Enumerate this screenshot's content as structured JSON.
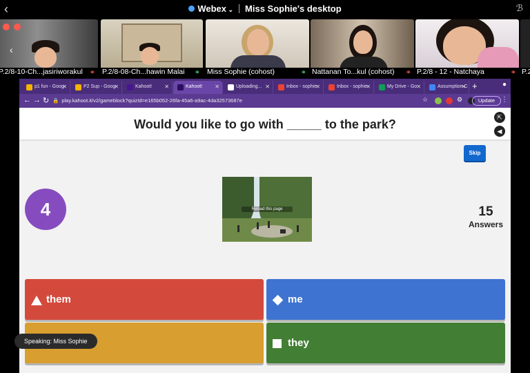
{
  "topbar": {
    "app_name": "Webex",
    "session_title": "Miss Sophie's desktop"
  },
  "participants": [
    {
      "name": "P.2/8-10-Ch...jasiriworakul",
      "mic": "off"
    },
    {
      "name": "P.2/8-08-Ch...hawin Malai",
      "mic": "on"
    },
    {
      "name": "Miss Sophie (cohost)",
      "mic": "on"
    },
    {
      "name": "Nattanan To...kul (cohost)",
      "mic": "off"
    },
    {
      "name": "P.2/8 - 12 - Natchaya",
      "mic": "off"
    },
    {
      "name": "P.2",
      "mic": "off"
    }
  ],
  "browser": {
    "tabs": [
      {
        "label": "p1 fun - Goog",
        "color": "#f4b400"
      },
      {
        "label": "P2 Sup - Goog",
        "color": "#f4b400"
      },
      {
        "label": "Kahoot!",
        "color": "#46178f"
      },
      {
        "label": "Kahoot!",
        "color": "#46178f"
      },
      {
        "label": "Uploading...",
        "color": "#ffffff"
      },
      {
        "label": "Inbox - sophie",
        "color": "#ea4335"
      },
      {
        "label": "Inbox - sophie",
        "color": "#ea4335"
      },
      {
        "label": "My Drive - Go",
        "color": "#0f9d58"
      },
      {
        "label": "Assumption C",
        "color": "#4285f4"
      }
    ],
    "url": "play.kahoot.it/v2/gameblock?quizId=e165b052-26fa-45a6-a9ac-4da32573687e",
    "update_label": "Update"
  },
  "game": {
    "question": "Would you like to go with _____ to the park?",
    "skip_label": "Skip",
    "timer": "4",
    "answers_count": "15",
    "answers_label": "Answers",
    "media_overlay": "Reload this page",
    "answers": [
      {
        "text": "them",
        "shape": "triangle"
      },
      {
        "text": "me",
        "shape": "diamond"
      },
      {
        "text": "",
        "shape": "circle"
      },
      {
        "text": "they",
        "shape": "square"
      }
    ]
  },
  "speaking_label": "Speaking: Miss Sophie"
}
